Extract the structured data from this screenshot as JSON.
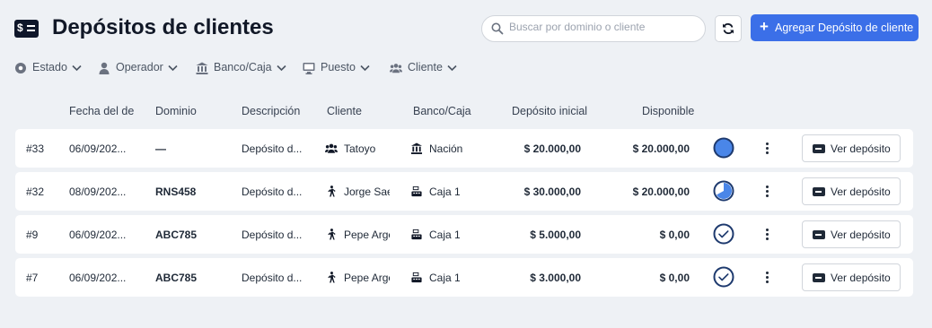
{
  "header": {
    "title": "Depósitos de clientes",
    "search_placeholder": "Buscar por dominio o cliente",
    "add_button": "Agregar Depósito de cliente",
    "title_icon": "money-icon"
  },
  "filters": [
    {
      "label": "Estado",
      "icon": "circle-dot-icon"
    },
    {
      "label": "Operador",
      "icon": "user-icon"
    },
    {
      "label": "Banco/Caja",
      "icon": "bank-icon"
    },
    {
      "label": "Puesto",
      "icon": "monitor-icon"
    },
    {
      "label": "Cliente",
      "icon": "users-icon"
    }
  ],
  "columns": [
    "Fecha del dep",
    "Dominio",
    "Descripción",
    "Cliente",
    "Banco/Caja",
    "Depósito inicial",
    "Disponible"
  ],
  "rows": [
    {
      "id": "#33",
      "fecha": "06/09/202...",
      "dominio": "—",
      "descripcion": "Depósito d...",
      "cliente": "Tatoyo",
      "cliente_icon": "users-icon",
      "banco": "Nación",
      "banco_icon": "bank-icon",
      "inicial": "$ 20.000,00",
      "disponible": "$ 20.000,00",
      "status": "full",
      "disponible_fraction": 1.0,
      "ver": "Ver depósito"
    },
    {
      "id": "#32",
      "fecha": "08/09/202...",
      "dominio": "RNS458",
      "descripcion": "Depósito d...",
      "cliente": "Jorge Saen",
      "cliente_icon": "walking-person-icon",
      "banco": "Caja 1",
      "banco_icon": "cash-register-icon",
      "inicial": "$ 30.000,00",
      "disponible": "$ 20.000,00",
      "status": "partial",
      "disponible_fraction": 0.67,
      "ver": "Ver depósito"
    },
    {
      "id": "#9",
      "fecha": "06/09/202...",
      "dominio": "ABC785",
      "descripcion": "Depósito d...",
      "cliente": "Pepe Arger",
      "cliente_icon": "walking-person-icon",
      "banco": "Caja 1",
      "banco_icon": "cash-register-icon",
      "inicial": "$ 5.000,00",
      "disponible": "$ 0,00",
      "status": "used",
      "disponible_fraction": 0.0,
      "ver": "Ver depósito"
    },
    {
      "id": "#7",
      "fecha": "06/09/202...",
      "dominio": "ABC785",
      "descripcion": "Depósito d...",
      "cliente": "Pepe Arger",
      "cliente_icon": "walking-person-icon",
      "banco": "Caja 1",
      "banco_icon": "cash-register-icon",
      "inicial": "$ 3.000,00",
      "disponible": "$ 0,00",
      "status": "used",
      "disponible_fraction": 0.0,
      "ver": "Ver depósito"
    }
  ],
  "colors": {
    "accent": "#3b6fe8",
    "status_full": "#4a86e8",
    "status_ring": "#1e3a6e"
  }
}
